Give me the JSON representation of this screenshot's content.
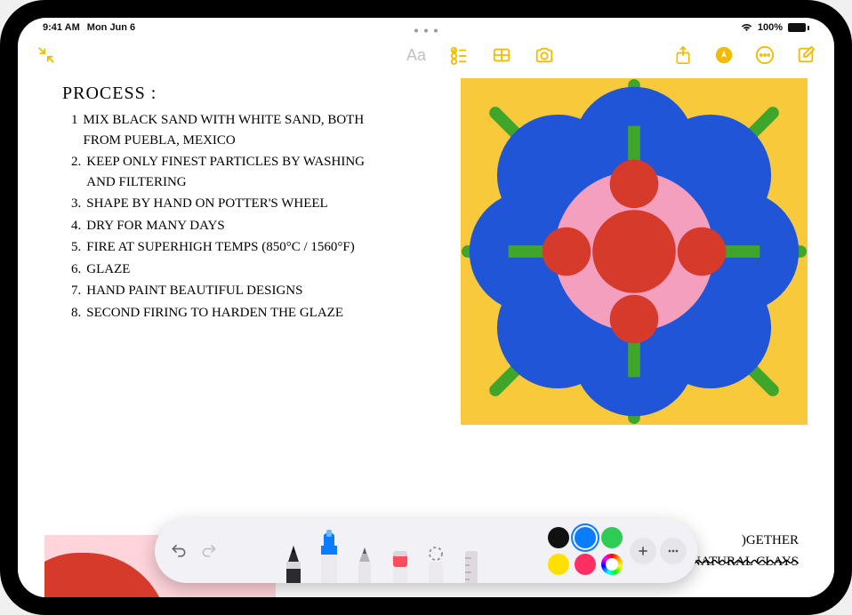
{
  "status": {
    "time": "9:41 AM",
    "date": "Mon Jun 6",
    "battery_pct": "100%"
  },
  "toolbar": {
    "format_text": "Aa"
  },
  "note": {
    "title": "PROCESS :",
    "items": [
      {
        "n": "1",
        "text": "Mix black sand with white sand, both from Puebla, Mexico"
      },
      {
        "n": "2.",
        "text": "Keep only finest particles by washing and filtering"
      },
      {
        "n": "3.",
        "text": "Shape by hand on potter's wheel"
      },
      {
        "n": "4.",
        "text": "Dry for many days"
      },
      {
        "n": "5.",
        "text": "Fire at superhigh temps (850°C / 1560°F)"
      },
      {
        "n": "6.",
        "text": "Glaze"
      },
      {
        "n": "7.",
        "text": "Hand paint beautiful designs"
      },
      {
        "n": "8.",
        "text": "Second firing to harden the glaze"
      }
    ],
    "bottom_text_1": ")GETHER",
    "bottom_text_2": "ONLY NATURAL CLAYS"
  },
  "drawing": {
    "bg": "#f8c93b",
    "petal": "#1f55d6",
    "stem": "#3fa62b",
    "center_ring": "#f59fbf",
    "dot": "#d63a2b"
  },
  "palette": {
    "colors": [
      "#111111",
      "#0a7cff",
      "#2ecc55",
      "#ffe100",
      "#ff2e63"
    ],
    "selected_index": 1
  }
}
